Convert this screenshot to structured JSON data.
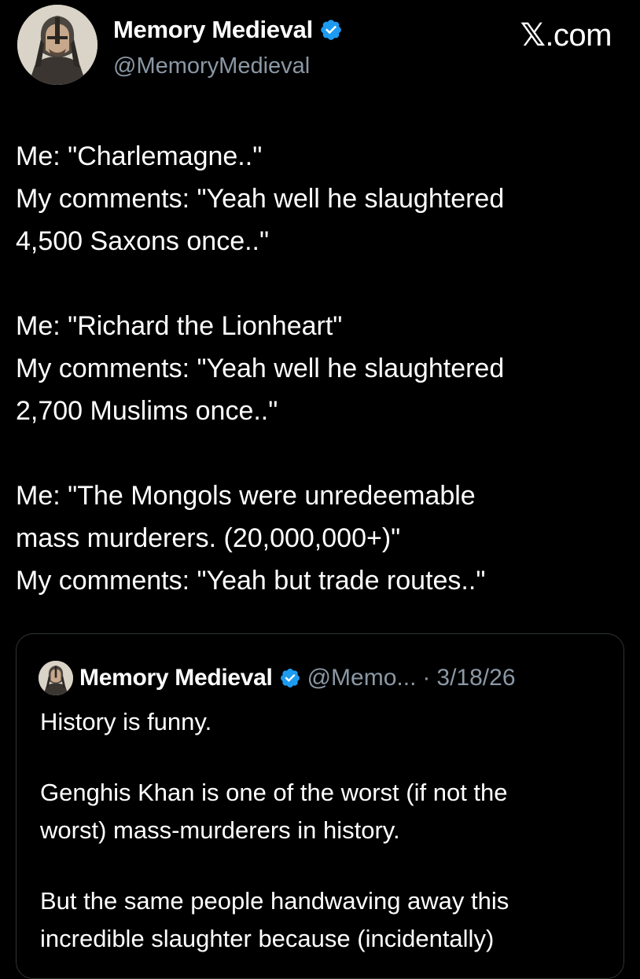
{
  "author": {
    "display_name": "Memory Medieval",
    "handle": "@MemoryMedieval",
    "verified_color": "#1d9bf0"
  },
  "brand": {
    "x_glyph": "𝕏",
    "domain": ".com"
  },
  "post": {
    "lines": [
      "Me: \"Charlemagne..\"",
      "My comments: \"Yeah well he slaughtered",
      "4,500 Saxons once..\"",
      "Me: \"Richard the Lionheart\"",
      "My comments: \"Yeah well he slaughtered",
      "2,700 Muslims once..\"",
      "Me: \"The Mongols were unredeemable",
      "mass murderers. (20,000,000+)\"",
      "My comments: \"Yeah but trade routes..\""
    ]
  },
  "quoted": {
    "display_name": "Memory Medieval",
    "handle_truncated": "@Memo...",
    "separator": "·",
    "date": "3/18/26",
    "lines": [
      "History is funny.",
      "Genghis Khan is one of the worst (if not the",
      "worst) mass-murderers in history.",
      "But the same people handwaving away this",
      "incredible slaughter because (incidentally)"
    ]
  }
}
